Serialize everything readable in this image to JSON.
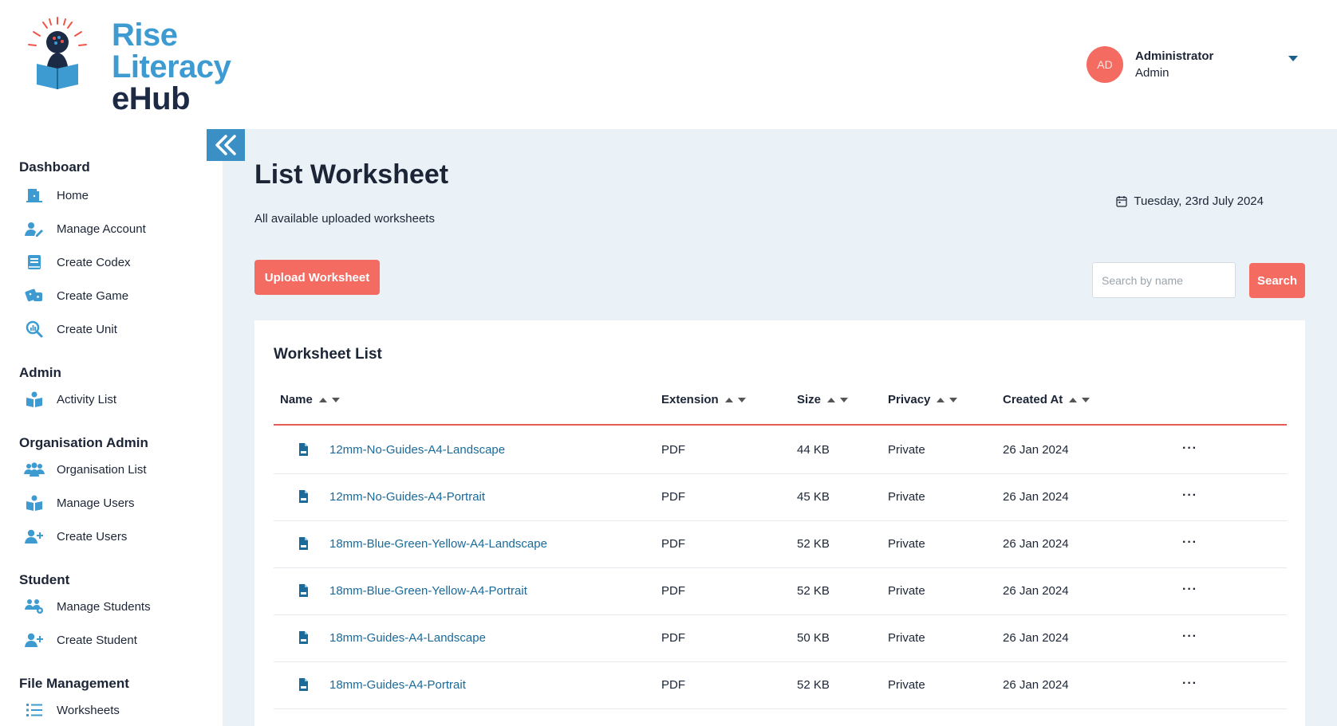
{
  "brand": {
    "line1": "Rise",
    "line2": "Literacy",
    "line3": "eHub"
  },
  "user": {
    "initials": "AD",
    "name": "Administrator",
    "role": "Admin"
  },
  "sidebar": {
    "sections": [
      {
        "title": "Dashboard",
        "items": [
          {
            "label": "Home",
            "icon": "door-icon"
          },
          {
            "label": "Manage Account",
            "icon": "user-edit-icon"
          },
          {
            "label": "Create Codex",
            "icon": "book-icon"
          },
          {
            "label": "Create Game",
            "icon": "dice-icon"
          },
          {
            "label": "Create Unit",
            "icon": "search-chart-icon"
          }
        ]
      },
      {
        "title": "Admin",
        "items": [
          {
            "label": "Activity List",
            "icon": "reader-icon"
          }
        ]
      },
      {
        "title": "Organisation Admin",
        "items": [
          {
            "label": "Organisation List",
            "icon": "users-group-icon"
          },
          {
            "label": "Manage Users",
            "icon": "reader-icon"
          },
          {
            "label": "Create Users",
            "icon": "user-plus-icon"
          }
        ]
      },
      {
        "title": "Student",
        "items": [
          {
            "label": "Manage Students",
            "icon": "users-gear-icon"
          },
          {
            "label": "Create Student",
            "icon": "user-plus-icon"
          }
        ]
      },
      {
        "title": "File Management",
        "items": [
          {
            "label": "Worksheets",
            "icon": "list-icon"
          }
        ]
      }
    ]
  },
  "main": {
    "title": "List Worksheet",
    "subtitle": "All available uploaded worksheets",
    "date": "Tuesday, 23rd July 2024",
    "upload_label": "Upload Worksheet",
    "search_placeholder": "Search by name",
    "search_label": "Search"
  },
  "table": {
    "title": "Worksheet List",
    "columns": [
      "Name",
      "Extension",
      "Size",
      "Privacy",
      "Created At"
    ],
    "rows": [
      {
        "name": "12mm-No-Guides-A4-Landscape",
        "ext": "PDF",
        "size": "44 KB",
        "privacy": "Private",
        "created": "26 Jan 2024"
      },
      {
        "name": "12mm-No-Guides-A4-Portrait",
        "ext": "PDF",
        "size": "45 KB",
        "privacy": "Private",
        "created": "26 Jan 2024"
      },
      {
        "name": "18mm-Blue-Green-Yellow-A4-Landscape",
        "ext": "PDF",
        "size": "52 KB",
        "privacy": "Private",
        "created": "26 Jan 2024"
      },
      {
        "name": "18mm-Blue-Green-Yellow-A4-Portrait",
        "ext": "PDF",
        "size": "52 KB",
        "privacy": "Private",
        "created": "26 Jan 2024"
      },
      {
        "name": "18mm-Guides-A4-Landscape",
        "ext": "PDF",
        "size": "50 KB",
        "privacy": "Private",
        "created": "26 Jan 2024"
      },
      {
        "name": "18mm-Guides-A4-Portrait",
        "ext": "PDF",
        "size": "52 KB",
        "privacy": "Private",
        "created": "26 Jan 2024"
      }
    ],
    "row_action": "···"
  },
  "colors": {
    "accent": "#f46b62",
    "brand_blue": "#3d9bd1",
    "link": "#1a6a9a",
    "main_bg": "#eaf2f8"
  }
}
